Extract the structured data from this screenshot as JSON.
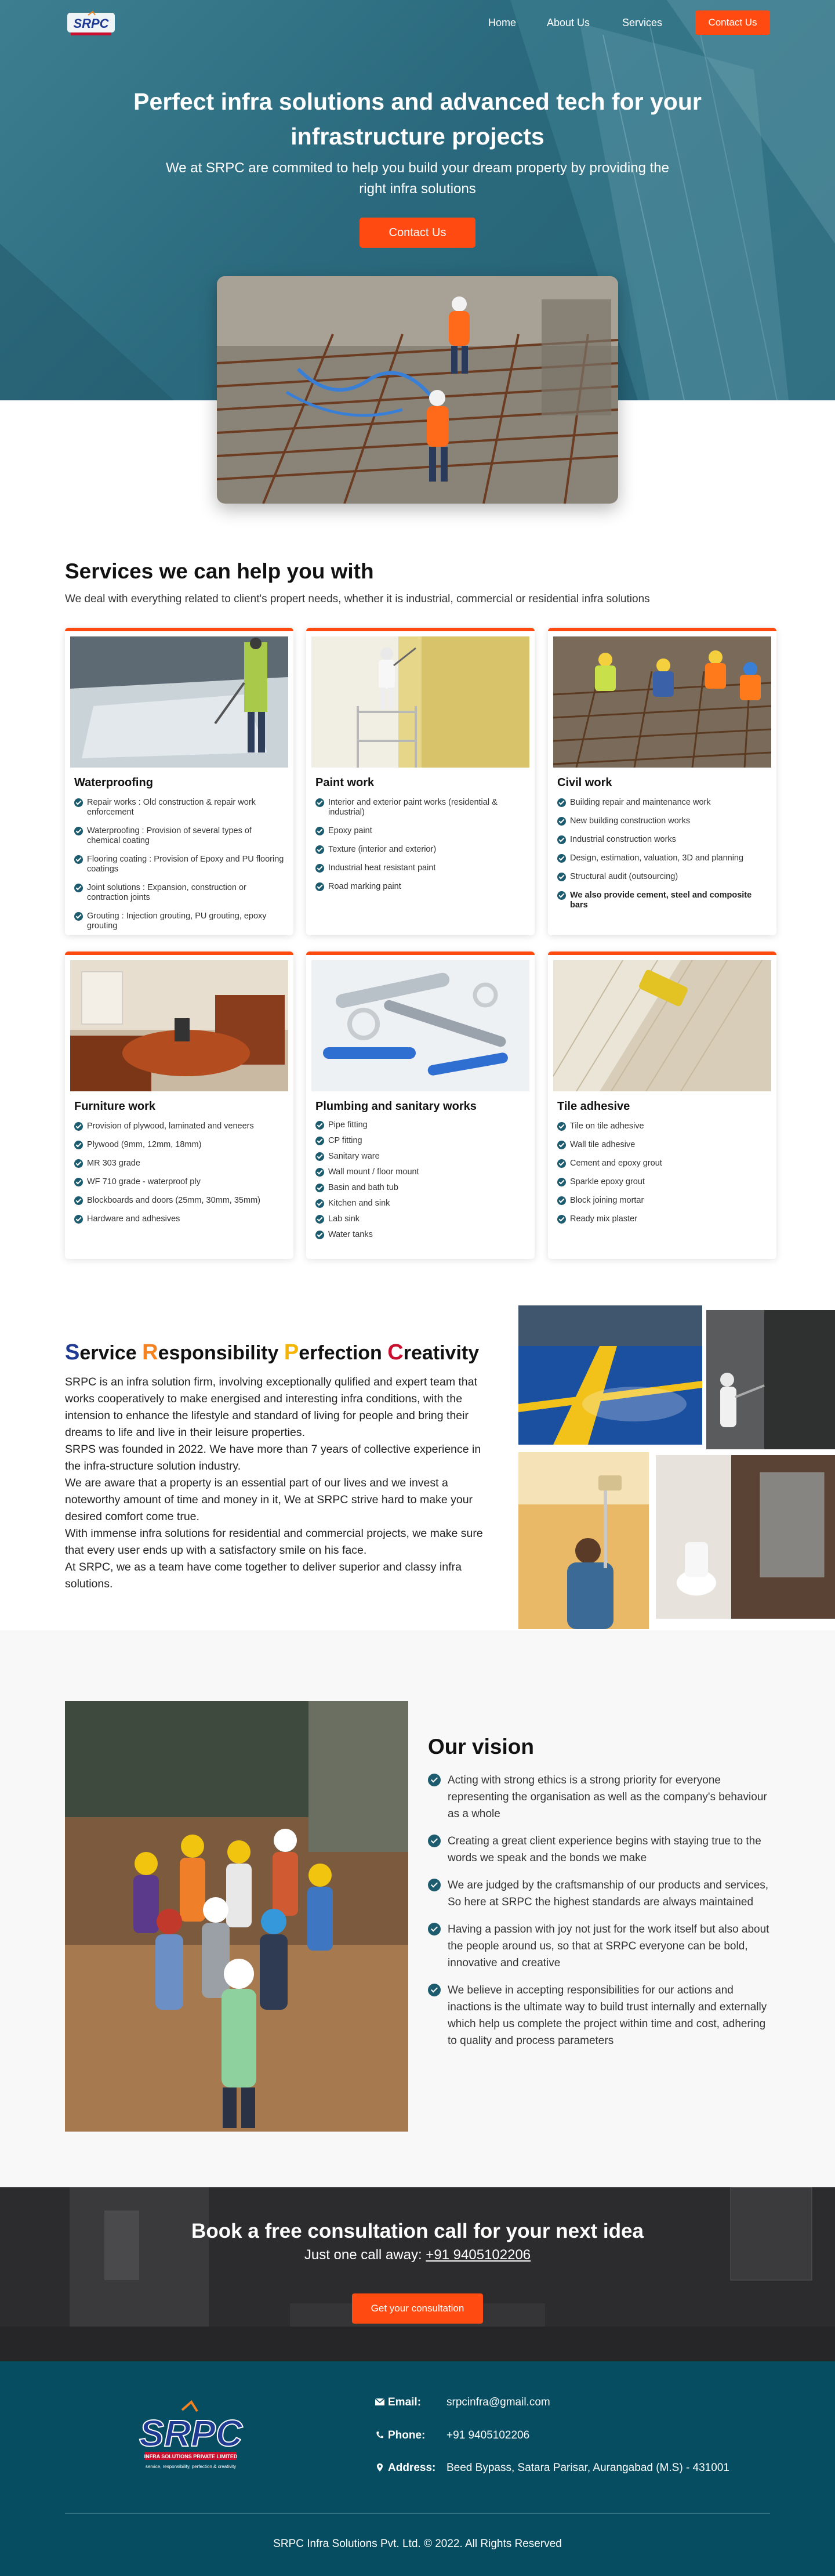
{
  "nav": {
    "logo_text": "SRPC",
    "links": [
      "Home",
      "About Us",
      "Services"
    ],
    "cta": "Contact Us"
  },
  "hero": {
    "title": "Perfect infra solutions and advanced tech for your infrastructure projects",
    "subtitle": "We at SRPC are commited to help you build your dream property by providing the right infra solutions",
    "cta": "Contact Us"
  },
  "services": {
    "title": "Services we can help you with",
    "subtitle": "We deal with everything related to client's propert needs, whether it is industrial, commercial or residential infra solutions",
    "cards": [
      {
        "title": "Waterproofing",
        "items": [
          "Repair works : Old construction & repair work enforcement",
          "Waterproofing : Provision of several types of chemical coating",
          "Flooring coating : Provision of Epoxy and PU flooring coatings",
          "Joint solutions : Expansion, construction or contraction joints",
          "Grouting : Injection grouting, PU grouting, epoxy grouting"
        ]
      },
      {
        "title": "Paint work",
        "items": [
          "Interior and exterior paint works (residential & industrial)",
          "Epoxy paint",
          "Texture (interior and exterior)",
          "Industrial heat resistant paint",
          "Road marking paint"
        ]
      },
      {
        "title": "Civil work",
        "items": [
          "Building repair and maintenance work",
          "New building construction works",
          "Industrial construction works",
          "Design, estimation, valuation, 3D and planning",
          "Structural audit (outsourcing)",
          "We also provide cement, steel and composite bars"
        ]
      },
      {
        "title": "Furniture work",
        "items": [
          "Provision of plywood, laminated and veneers",
          "Plywood (9mm, 12mm, 18mm)",
          "MR 303 grade",
          "WF 710 grade - waterproof ply",
          "Blockboards and doors (25mm, 30mm, 35mm)",
          "Hardware and adhesives"
        ]
      },
      {
        "title": "Plumbing and sanitary works",
        "items": [
          "Pipe fitting",
          "CP fitting",
          "Sanitary ware",
          "Wall mount / floor mount",
          "Basin and bath tub",
          "Kitchen and sink",
          "Lab sink",
          "Water tanks"
        ]
      },
      {
        "title": "Tile adhesive",
        "items": [
          "Tile on tile adhesive",
          "Wall tile adhesive",
          "Cement and epoxy grout",
          "Sparkle epoxy grout",
          "Block joining mortar",
          "Ready mix plaster"
        ]
      }
    ]
  },
  "about": {
    "title_words": [
      {
        "initial": "S",
        "rest": "ervice",
        "color": "#1f3a93"
      },
      {
        "initial": "R",
        "rest": "esponsibility",
        "color": "#f58220"
      },
      {
        "initial": "P",
        "rest": "erfection",
        "color": "#f5b400"
      },
      {
        "initial": "C",
        "rest": "reativity",
        "color": "#c8102e"
      }
    ],
    "paragraphs": [
      "SRPC is an infra solution firm, involving exceptionally qulified and expert team that works cooperatively to make energised and interesting infra conditions, with the intension to enhance the lifestyle and standard of living for people and bring their dreams to life and live in their leisure properties.",
      "SRPS was founded in 2022. We have more than 7 years of collective experience in the infra-structure solution industry.",
      "We are aware that a property is an essential part of our lives and we invest a noteworthy amount of time and money in it, We at SRPC strive hard to make your desired comfort come true.",
      "With immense infra solutions for residential and commercial projects, we make sure that every user ends up with a satisfactory smile on his face.",
      "At SRPC, we as a team have come together to deliver superior and classy infra solutions."
    ]
  },
  "vision": {
    "title": "Our vision",
    "items": [
      "Acting with strong ethics is a strong priority for everyone representing the organisation as well as the company's behaviour as a whole",
      "Creating a great client experience begins with staying true to the words we speak and the bonds we make",
      "We are judged by the craftsmanship of our products and services, So here at SRPC the highest standards are always maintained",
      "Having a passion with joy not just for the work itself but also about the people around us, so that at SRPC everyone can be bold, innovative and creative",
      "We believe in accepting responsibilities for our actions and inactions is the ultimate way to build trust internally and externally which help us complete the project within time and cost, adhering to quality and process parameters"
    ]
  },
  "consult": {
    "title": "Book a free consultation call for your next idea",
    "sub_prefix": "Just one call away:",
    "phone": "+91 9405102206",
    "cta": "Get your consultation"
  },
  "footer": {
    "logo_text": "SRPC",
    "logo_tagline": "INFRA SOLUTIONS PRIVATE LIMITED",
    "logo_motto": "service, responsibility, perfection & creativity",
    "email_label": "Email:",
    "email": "srpcinfra@gmail.com",
    "phone_label": "Phone:",
    "phone": "+91 9405102206",
    "address_label": "Address:",
    "address": "Beed Bypass, Satara Parisar, Aurangabad (M.S) - 431001",
    "copyright": "SRPC Infra Solutions Pvt. Ltd. © 2022. All Rights Reserved"
  },
  "icons": [
    "logo",
    "check-icon",
    "email-icon",
    "phone-icon",
    "location-icon"
  ],
  "colors": {
    "accent": "#ff4b12",
    "hero": "#2b6a7e",
    "footer": "#064d62",
    "check": "#1d5c6e"
  }
}
